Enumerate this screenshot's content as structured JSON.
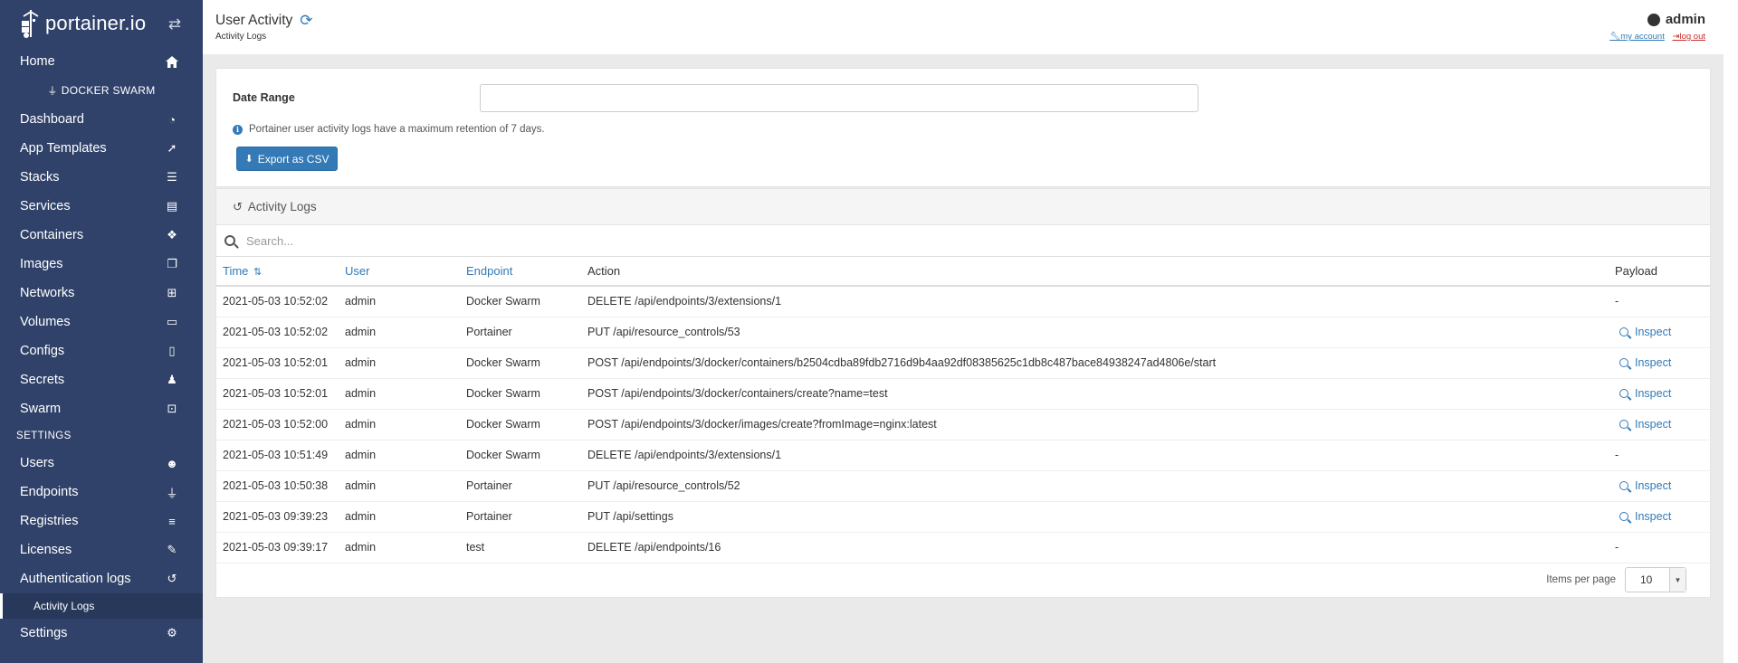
{
  "brand": {
    "name": "portainer.io"
  },
  "sidebar": {
    "home": "Home",
    "environment": "DOCKER SWARM",
    "items": [
      {
        "label": "Dashboard",
        "icon": "tachometer-icon"
      },
      {
        "label": "App Templates",
        "icon": "rocket-icon"
      },
      {
        "label": "Stacks",
        "icon": "th-list-icon"
      },
      {
        "label": "Services",
        "icon": "list-alt-icon"
      },
      {
        "label": "Containers",
        "icon": "cubes-icon"
      },
      {
        "label": "Images",
        "icon": "clone-icon"
      },
      {
        "label": "Networks",
        "icon": "sitemap-icon"
      },
      {
        "label": "Volumes",
        "icon": "hdd-icon"
      },
      {
        "label": "Configs",
        "icon": "file-code-icon"
      },
      {
        "label": "Secrets",
        "icon": "user-secret-icon"
      },
      {
        "label": "Swarm",
        "icon": "object-group-icon"
      }
    ],
    "settings_section": "SETTINGS",
    "settings_items": [
      {
        "label": "Users",
        "icon": "users-icon"
      },
      {
        "label": "Endpoints",
        "icon": "plug-icon"
      },
      {
        "label": "Registries",
        "icon": "database-icon"
      },
      {
        "label": "Licenses",
        "icon": "file-signature-icon"
      },
      {
        "label": "Authentication logs",
        "icon": "history-icon"
      }
    ],
    "active_sub_item": "Activity Logs",
    "settings_bottom": "Settings"
  },
  "header": {
    "title": "User Activity",
    "breadcrumb": "Activity Logs",
    "username": "admin",
    "my_account": "my account",
    "log_out": "log out"
  },
  "filter": {
    "date_range_label": "Date Range",
    "date_range_value": "",
    "info": "Portainer user activity logs have a maximum retention of 7 days.",
    "export_button": "Export as CSV"
  },
  "logs": {
    "title": "Activity Logs",
    "search_placeholder": "Search...",
    "columns": {
      "time": "Time",
      "user": "User",
      "endpoint": "Endpoint",
      "action": "Action",
      "payload": "Payload"
    },
    "inspect_label": "Inspect",
    "rows": [
      {
        "time": "2021-05-03 10:52:02",
        "user": "admin",
        "endpoint": "Docker Swarm",
        "action": "DELETE /api/endpoints/3/extensions/1",
        "payload": "-"
      },
      {
        "time": "2021-05-03 10:52:02",
        "user": "admin",
        "endpoint": "Portainer",
        "action": "PUT /api/resource_controls/53",
        "payload": "Inspect"
      },
      {
        "time": "2021-05-03 10:52:01",
        "user": "admin",
        "endpoint": "Docker Swarm",
        "action": "POST /api/endpoints/3/docker/containers/b2504cdba89fdb2716d9b4aa92df08385625c1db8c487bace84938247ad4806e/start",
        "payload": "Inspect"
      },
      {
        "time": "2021-05-03 10:52:01",
        "user": "admin",
        "endpoint": "Docker Swarm",
        "action": "POST /api/endpoints/3/docker/containers/create?name=test",
        "payload": "Inspect"
      },
      {
        "time": "2021-05-03 10:52:00",
        "user": "admin",
        "endpoint": "Docker Swarm",
        "action": "POST /api/endpoints/3/docker/images/create?fromImage=nginx:latest",
        "payload": "Inspect"
      },
      {
        "time": "2021-05-03 10:51:49",
        "user": "admin",
        "endpoint": "Docker Swarm",
        "action": "DELETE /api/endpoints/3/extensions/1",
        "payload": "-"
      },
      {
        "time": "2021-05-03 10:50:38",
        "user": "admin",
        "endpoint": "Portainer",
        "action": "PUT /api/resource_controls/52",
        "payload": "Inspect"
      },
      {
        "time": "2021-05-03 09:39:23",
        "user": "admin",
        "endpoint": "Portainer",
        "action": "PUT /api/settings",
        "payload": "Inspect"
      },
      {
        "time": "2021-05-03 09:39:17",
        "user": "admin",
        "endpoint": "test",
        "action": "DELETE /api/endpoints/16",
        "payload": "-"
      }
    ],
    "items_per_page_label": "Items per page",
    "items_per_page": "10"
  },
  "colors": {
    "sidebar": "#30426a",
    "accent": "#337ab7",
    "logout": "#c9302c"
  }
}
